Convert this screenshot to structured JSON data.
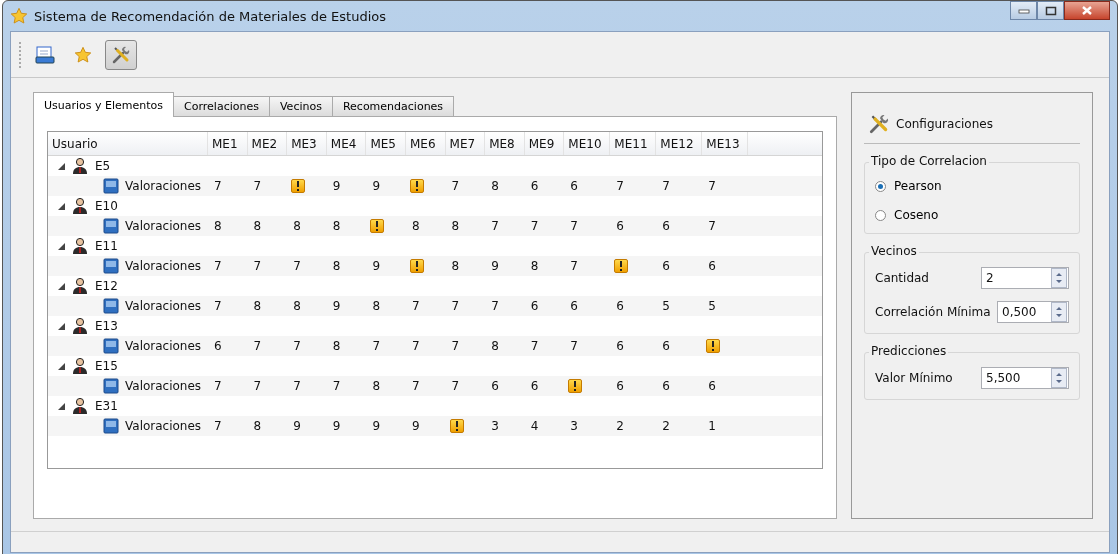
{
  "window": {
    "title": "Sistema de Recomendación de Materiales de Estudios"
  },
  "toolbar": [
    {
      "kind": "document",
      "selected": false
    },
    {
      "kind": "star",
      "selected": false
    },
    {
      "kind": "tools",
      "selected": true
    }
  ],
  "tabs": [
    {
      "label": "Usuarios y Elementos",
      "selected": true
    },
    {
      "label": "Correlaciones",
      "selected": false
    },
    {
      "label": "Vecinos",
      "selected": false
    },
    {
      "label": "Recomendaciones",
      "selected": false
    }
  ],
  "table": {
    "columns": [
      "Usuario",
      "ME1",
      "ME2",
      "ME3",
      "ME4",
      "ME5",
      "ME6",
      "ME7",
      "ME8",
      "ME9",
      "ME10",
      "ME11",
      "ME12",
      "ME13"
    ],
    "rows": [
      {
        "label": "E5",
        "expanded": true,
        "children": [
          {
            "label": "Valoraciones",
            "cells": [
              {
                "kind": "value",
                "text": "7"
              },
              {
                "kind": "value",
                "text": "7"
              },
              {
                "kind": "warning"
              },
              {
                "kind": "value",
                "text": "9"
              },
              {
                "kind": "value",
                "text": "9"
              },
              {
                "kind": "warning"
              },
              {
                "kind": "value",
                "text": "7"
              },
              {
                "kind": "value",
                "text": "8"
              },
              {
                "kind": "value",
                "text": "6"
              },
              {
                "kind": "value",
                "text": "6"
              },
              {
                "kind": "value",
                "text": "7"
              },
              {
                "kind": "value",
                "text": "7"
              },
              {
                "kind": "value",
                "text": "7"
              }
            ]
          }
        ]
      },
      {
        "label": "E10",
        "expanded": true,
        "children": [
          {
            "label": "Valoraciones",
            "cells": [
              {
                "kind": "value",
                "text": "8"
              },
              {
                "kind": "value",
                "text": "8"
              },
              {
                "kind": "value",
                "text": "8"
              },
              {
                "kind": "value",
                "text": "8"
              },
              {
                "kind": "warning"
              },
              {
                "kind": "value",
                "text": "8"
              },
              {
                "kind": "value",
                "text": "8"
              },
              {
                "kind": "value",
                "text": "7"
              },
              {
                "kind": "value",
                "text": "7"
              },
              {
                "kind": "value",
                "text": "7"
              },
              {
                "kind": "value",
                "text": "6"
              },
              {
                "kind": "value",
                "text": "6"
              },
              {
                "kind": "value",
                "text": "7"
              }
            ]
          }
        ]
      },
      {
        "label": "E11",
        "expanded": true,
        "children": [
          {
            "label": "Valoraciones",
            "cells": [
              {
                "kind": "value",
                "text": "7"
              },
              {
                "kind": "value",
                "text": "7"
              },
              {
                "kind": "value",
                "text": "7"
              },
              {
                "kind": "value",
                "text": "8"
              },
              {
                "kind": "value",
                "text": "9"
              },
              {
                "kind": "warning"
              },
              {
                "kind": "value",
                "text": "8"
              },
              {
                "kind": "value",
                "text": "9"
              },
              {
                "kind": "value",
                "text": "8"
              },
              {
                "kind": "value",
                "text": "7"
              },
              {
                "kind": "warning"
              },
              {
                "kind": "value",
                "text": "6"
              },
              {
                "kind": "value",
                "text": "6"
              }
            ]
          }
        ]
      },
      {
        "label": "E12",
        "expanded": true,
        "children": [
          {
            "label": "Valoraciones",
            "cells": [
              {
                "kind": "value",
                "text": "7"
              },
              {
                "kind": "value",
                "text": "8"
              },
              {
                "kind": "value",
                "text": "8"
              },
              {
                "kind": "value",
                "text": "9"
              },
              {
                "kind": "value",
                "text": "8"
              },
              {
                "kind": "value",
                "text": "7"
              },
              {
                "kind": "value",
                "text": "7"
              },
              {
                "kind": "value",
                "text": "7"
              },
              {
                "kind": "value",
                "text": "6"
              },
              {
                "kind": "value",
                "text": "6"
              },
              {
                "kind": "value",
                "text": "6"
              },
              {
                "kind": "value",
                "text": "5"
              },
              {
                "kind": "value",
                "text": "5"
              }
            ]
          }
        ]
      },
      {
        "label": "E13",
        "expanded": true,
        "children": [
          {
            "label": "Valoraciones",
            "cells": [
              {
                "kind": "value",
                "text": "6"
              },
              {
                "kind": "value",
                "text": "7"
              },
              {
                "kind": "value",
                "text": "7"
              },
              {
                "kind": "value",
                "text": "8"
              },
              {
                "kind": "value",
                "text": "7"
              },
              {
                "kind": "value",
                "text": "7"
              },
              {
                "kind": "value",
                "text": "7"
              },
              {
                "kind": "value",
                "text": "8"
              },
              {
                "kind": "value",
                "text": "7"
              },
              {
                "kind": "value",
                "text": "7"
              },
              {
                "kind": "value",
                "text": "6"
              },
              {
                "kind": "value",
                "text": "6"
              },
              {
                "kind": "warning"
              }
            ]
          }
        ]
      },
      {
        "label": "E15",
        "expanded": true,
        "children": [
          {
            "label": "Valoraciones",
            "cells": [
              {
                "kind": "value",
                "text": "7"
              },
              {
                "kind": "value",
                "text": "7"
              },
              {
                "kind": "value",
                "text": "7"
              },
              {
                "kind": "value",
                "text": "7"
              },
              {
                "kind": "value",
                "text": "8"
              },
              {
                "kind": "value",
                "text": "7"
              },
              {
                "kind": "value",
                "text": "7"
              },
              {
                "kind": "value",
                "text": "6"
              },
              {
                "kind": "value",
                "text": "6"
              },
              {
                "kind": "warning"
              },
              {
                "kind": "value",
                "text": "6"
              },
              {
                "kind": "value",
                "text": "6"
              },
              {
                "kind": "value",
                "text": "6"
              }
            ]
          }
        ]
      },
      {
        "label": "E31",
        "expanded": true,
        "children": [
          {
            "label": "Valoraciones",
            "cells": [
              {
                "kind": "value",
                "text": "7"
              },
              {
                "kind": "value",
                "text": "8"
              },
              {
                "kind": "value",
                "text": "9"
              },
              {
                "kind": "value",
                "text": "9"
              },
              {
                "kind": "value",
                "text": "9"
              },
              {
                "kind": "value",
                "text": "9"
              },
              {
                "kind": "warning"
              },
              {
                "kind": "value",
                "text": "3"
              },
              {
                "kind": "value",
                "text": "4"
              },
              {
                "kind": "value",
                "text": "3"
              },
              {
                "kind": "value",
                "text": "2"
              },
              {
                "kind": "value",
                "text": "2"
              },
              {
                "kind": "value",
                "text": "1"
              }
            ]
          }
        ]
      }
    ]
  },
  "settings": {
    "title": "Configuraciones",
    "correlation": {
      "title": "Tipo de Correlacion",
      "options": [
        {
          "label": "Pearson",
          "selected": true
        },
        {
          "label": "Coseno",
          "selected": false
        }
      ]
    },
    "neighbors": {
      "title": "Vecinos",
      "fields": [
        {
          "label": "Cantidad",
          "value": "2"
        },
        {
          "label": "Correlación Mínima",
          "value": "0,500"
        }
      ]
    },
    "predictions": {
      "title": "Predicciones",
      "fields": [
        {
          "label": "Valor Mínimo",
          "value": "5,500"
        }
      ]
    }
  }
}
